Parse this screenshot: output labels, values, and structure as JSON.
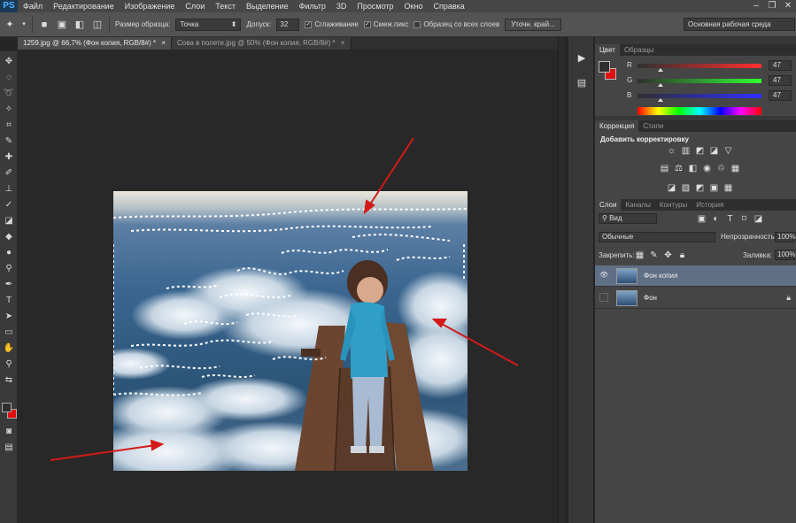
{
  "app": {
    "logo": "PS"
  },
  "menu": [
    "Файл",
    "Редактирование",
    "Изображение",
    "Слои",
    "Текст",
    "Выделение",
    "Фильтр",
    "3D",
    "Просмотр",
    "Окно",
    "Справка"
  ],
  "window_controls": {
    "minimize": "–",
    "restore": "❐",
    "close": "✕"
  },
  "options_bar": {
    "sample_size_label": "Размер образца:",
    "sample_size_value": "Точка",
    "tolerance_label": "Допуск:",
    "tolerance_value": "32",
    "antialias_label": "Сглаживание",
    "contiguous_label": "Смеж.пикс",
    "sample_all_label": "Образец со всех слоев",
    "refine_button": "Уточн. край...",
    "workspace": "Основная рабочая среда"
  },
  "tabs": [
    {
      "label": "1259.jpg @ 66,7% (Фон копия, RGB/8#) *",
      "close": "×"
    },
    {
      "label": "Сова в полете.jpg @ 50% (Фон копия, RGB/8#) *",
      "close": "×"
    }
  ],
  "color_panel": {
    "tabs": [
      "Цвет",
      "Образцы"
    ],
    "channels": [
      {
        "label": "R",
        "value": "47",
        "fill": 0.18
      },
      {
        "label": "G",
        "value": "47",
        "fill": 0.18
      },
      {
        "label": "B",
        "value": "47",
        "fill": 0.18
      }
    ],
    "foreground": "#2f2f2f",
    "background": "#e01010"
  },
  "adjust_panel": {
    "tabs": [
      "Коррекция",
      "Стили"
    ],
    "title": "Добавить корректировку"
  },
  "layers_panel": {
    "tabs": [
      "Слои",
      "Каналы",
      "Контуры",
      "История"
    ],
    "kind_filter": "Вид",
    "blend_mode": "Обычные",
    "opacity_label": "Непрозрачность:",
    "opacity_value": "100%",
    "lock_label": "Закрепить:",
    "fill_label": "Заливка:",
    "fill_value": "100%",
    "layers": [
      {
        "name": "Фон копия",
        "visible": true,
        "selected": true
      },
      {
        "name": "Фон",
        "visible": false,
        "selected": false
      }
    ]
  },
  "colors": {
    "accent": "#5f6f86",
    "arrow": "#d31a1a",
    "selection": "#ffffff"
  }
}
